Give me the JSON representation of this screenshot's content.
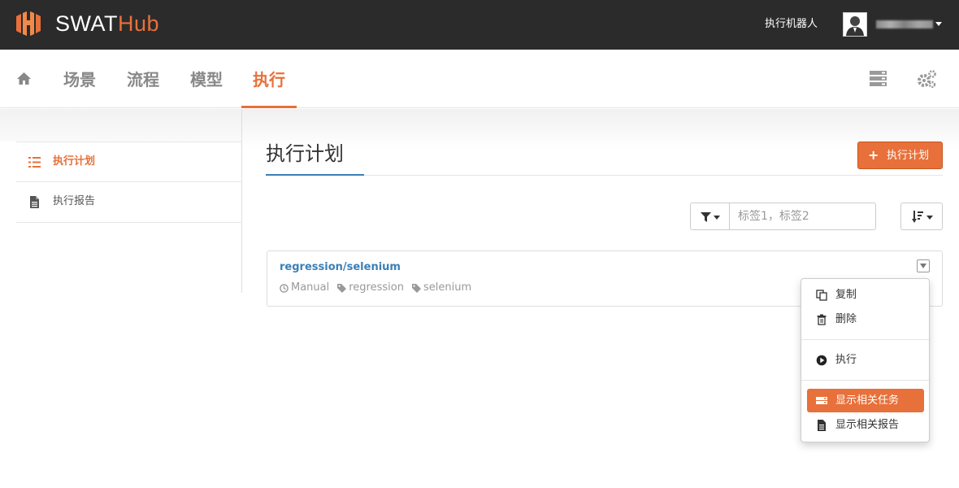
{
  "app": {
    "name_part1": "SWAT",
    "name_part2": "Hub"
  },
  "topbar": {
    "robot_link": "执行机器人"
  },
  "nav": {
    "items": [
      "场景",
      "流程",
      "模型",
      "执行"
    ],
    "active": "执行"
  },
  "sidebar": {
    "items": [
      {
        "label": "执行计划",
        "active": true
      },
      {
        "label": "执行报告",
        "active": false
      }
    ]
  },
  "main": {
    "title": "执行计划",
    "add_button": "执行计划",
    "add_button_icon": "+",
    "filter": {
      "placeholder": "标签1，标签2",
      "value": ""
    }
  },
  "plans": [
    {
      "title": "regression/selenium",
      "trigger": "Manual",
      "tags": [
        "regression",
        "selenium"
      ]
    }
  ],
  "dropdown": {
    "items": [
      {
        "label": "复制"
      },
      {
        "label": "删除"
      },
      {
        "label": "执行"
      },
      {
        "label": "显示相关任务",
        "highlighted": true
      },
      {
        "label": "显示相关报告"
      }
    ]
  },
  "colors": {
    "accent": "#e8703a",
    "link": "#3a7fb6",
    "topbar": "#2b2b2b"
  }
}
